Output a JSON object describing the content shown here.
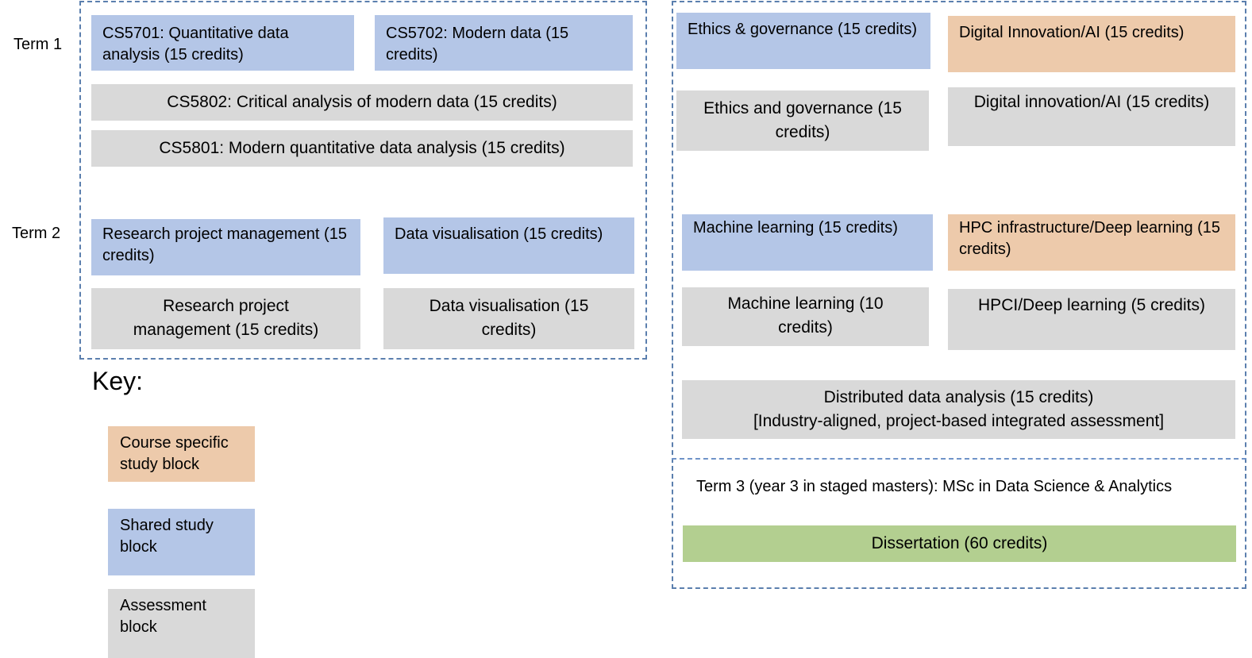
{
  "term_labels": {
    "term1": "Term 1",
    "term2": "Term 2",
    "term3": "Term 3 (year 3 in staged masters): MSc in Data Science & Analytics"
  },
  "colors": {
    "course_specific": "#edcaab",
    "shared": "#b4c6e7",
    "assessment": "#d9d9d9",
    "dissertation": "#b3cf90",
    "frame": "#5b7fae"
  },
  "left_panel": {
    "term1": {
      "shared": [
        "CS5701: Quantitative data analysis (15 credits)",
        "CS5702: Modern data (15 credits)"
      ],
      "assessment": [
        "CS5802: Critical analysis of modern data (15 credits)",
        "CS5801: Modern quantitative data analysis (15 credits)"
      ]
    },
    "term2": {
      "shared": [
        "Research project management (15 credits)",
        "Data visualisation (15 credits)"
      ],
      "assessment": [
        "Research project management (15 credits)",
        "Data visualisation (15 credits)"
      ]
    }
  },
  "right_panel": {
    "term1": {
      "shared": "Ethics & governance (15 credits)",
      "course": "Digital Innovation/AI (15 credits)",
      "assessment": [
        "Ethics and governance (15 credits)",
        "Digital innovation/AI (15 credits)"
      ]
    },
    "term2": {
      "shared": "Machine learning (15 credits)",
      "course": "HPC infrastructure/Deep learning (15 credits)",
      "assessment": [
        "Machine learning (10 credits)",
        "HPCI/Deep learning (5 credits)"
      ],
      "integrated": {
        "line1": "Distributed data analysis (15 credits)",
        "line2": "[Industry-aligned, project-based integrated assessment]"
      }
    },
    "term3": {
      "dissertation": "Dissertation (60 credits)"
    }
  },
  "key": {
    "title": "Key:",
    "items": [
      {
        "label": "Course specific study block",
        "type": "course"
      },
      {
        "label": "Shared study block",
        "type": "shared"
      },
      {
        "label": "Assessment block",
        "type": "assessment"
      }
    ]
  }
}
